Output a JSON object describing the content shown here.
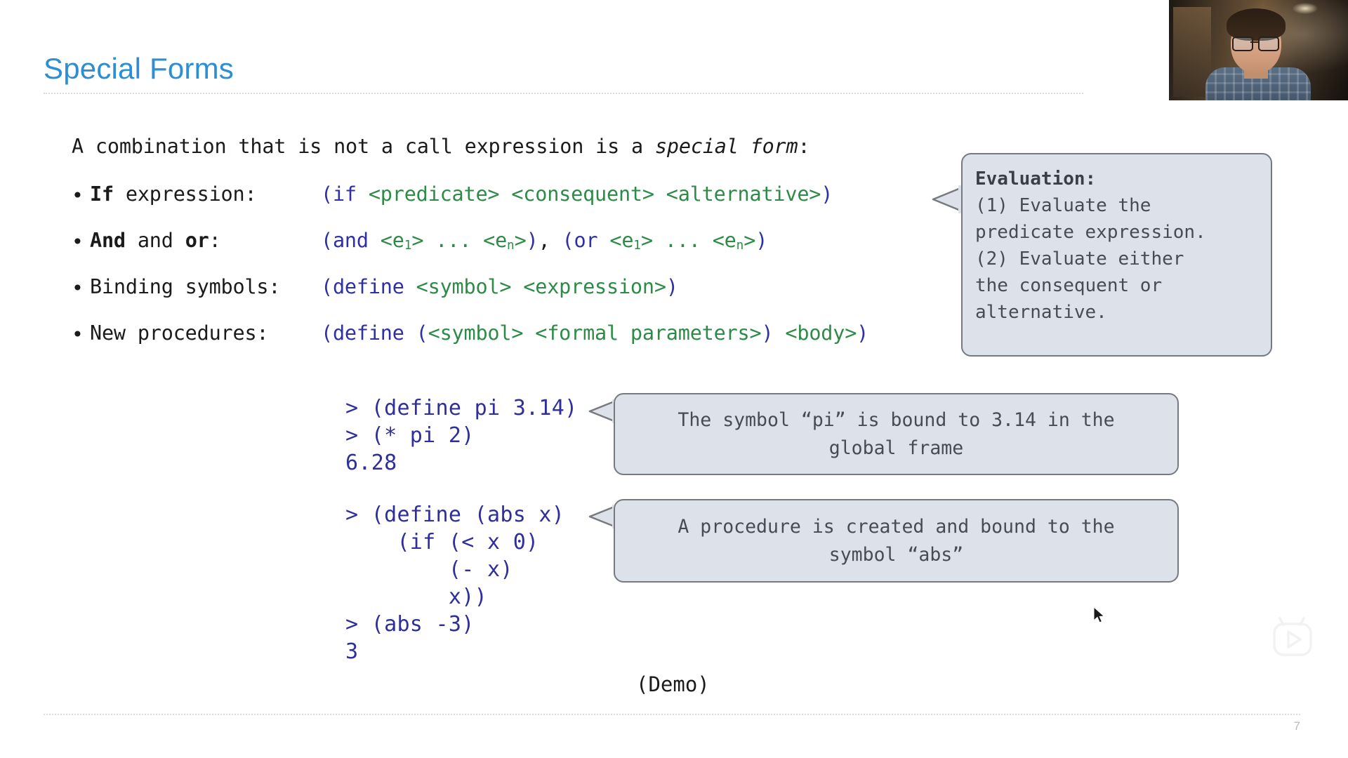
{
  "slide": {
    "title": "Special Forms",
    "page_number": "7",
    "accent_color": "#2e8ed4",
    "code_blue": "#2f2fa8",
    "code_green": "#2e8b47",
    "repl_color": "#2e2e9c",
    "callout_fill": "#dde2ea",
    "callout_border": "#767a80"
  },
  "intro": {
    "before": "A combination that is not a call expression is a ",
    "emphasis": "special form",
    "after": ":"
  },
  "bullets": [
    {
      "label_bold": "If",
      "label_rest": " expression:",
      "code_open": "(if ",
      "code_args": "<predicate> <consequent> <alternative>",
      "code_close": ")"
    },
    {
      "label_bold": "And",
      "label_mid": " and ",
      "label_bold2": "or",
      "label_rest": ":",
      "code_and_open": "(and ",
      "code_and_args_1": "<e",
      "code_and_sub_1": "1",
      "code_and_args_2": "> ... <e",
      "code_and_sub_2": "n",
      "code_and_args_3": ">",
      "code_and_close": ")",
      "code_sep": ", ",
      "code_or_open": "(or ",
      "code_or_close": ")"
    },
    {
      "label_rest": "Binding symbols:",
      "code_open": "(define ",
      "code_args": "<symbol> <expression>",
      "code_close": ")"
    },
    {
      "label_rest": "New procedures:",
      "code_open": "(define (",
      "code_args": "<symbol> <formal parameters>",
      "code_close": ") ",
      "code_args2": "<body>",
      "code_close2": ")"
    }
  ],
  "callout_evaluation": {
    "heading": "Evaluation:",
    "lines": [
      "(1) Evaluate the",
      "predicate expression.",
      "(2) Evaluate either",
      "the consequent or",
      "alternative."
    ]
  },
  "repl_block_1": {
    "lines": [
      "> (define pi 3.14)",
      "> (* pi 2)",
      "6.28"
    ]
  },
  "repl_block_2": {
    "lines": [
      "> (define (abs x)",
      "    (if (< x 0)",
      "        (- x)",
      "        x))",
      "> (abs -3)",
      "3"
    ]
  },
  "bubble_pi": {
    "line1": "The symbol “pi” is bound to 3.14 in the",
    "line2": "global frame"
  },
  "bubble_abs": {
    "line1": "A procedure is created and bound to the",
    "line2": "symbol “abs”"
  },
  "demo": {
    "label": "(Demo)"
  },
  "webcam": {
    "alt": "presenter-video-thumbnail"
  },
  "play_widget": {
    "alt": "play-button-watermark"
  }
}
